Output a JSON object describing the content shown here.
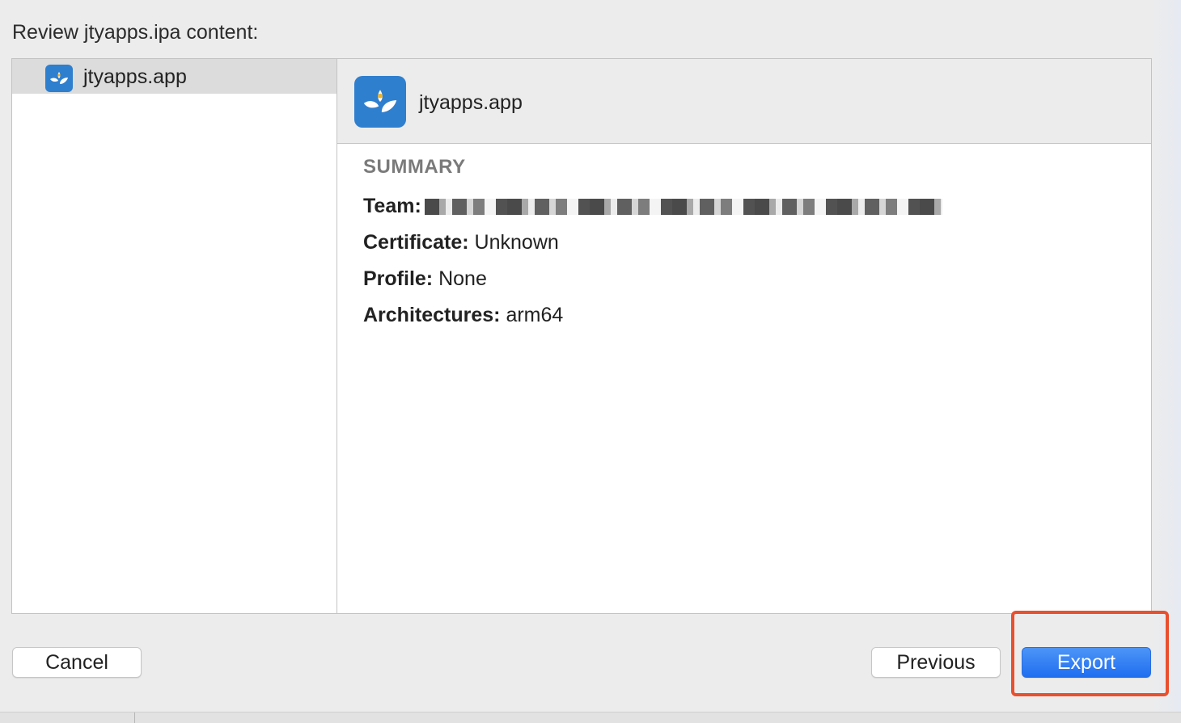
{
  "dialog": {
    "title": "Review jtyapps.ipa content:"
  },
  "sidebar": {
    "items": [
      {
        "label": "jtyapps.app",
        "icon": "app-icon",
        "selected": true
      }
    ]
  },
  "detail": {
    "app_name": "jtyapps.app",
    "summary_heading": "SUMMARY",
    "rows": [
      {
        "key": "Team:",
        "value": ""
      },
      {
        "key": "Certificate:",
        "value": "Unknown"
      },
      {
        "key": "Profile:",
        "value": "None"
      },
      {
        "key": "Architectures:",
        "value": "arm64"
      }
    ]
  },
  "buttons": {
    "cancel": "Cancel",
    "previous": "Previous",
    "export": "Export"
  },
  "colors": {
    "accent": "#1f6ef0",
    "highlight": "#e8502e",
    "app_icon": "#2f7fcf"
  }
}
